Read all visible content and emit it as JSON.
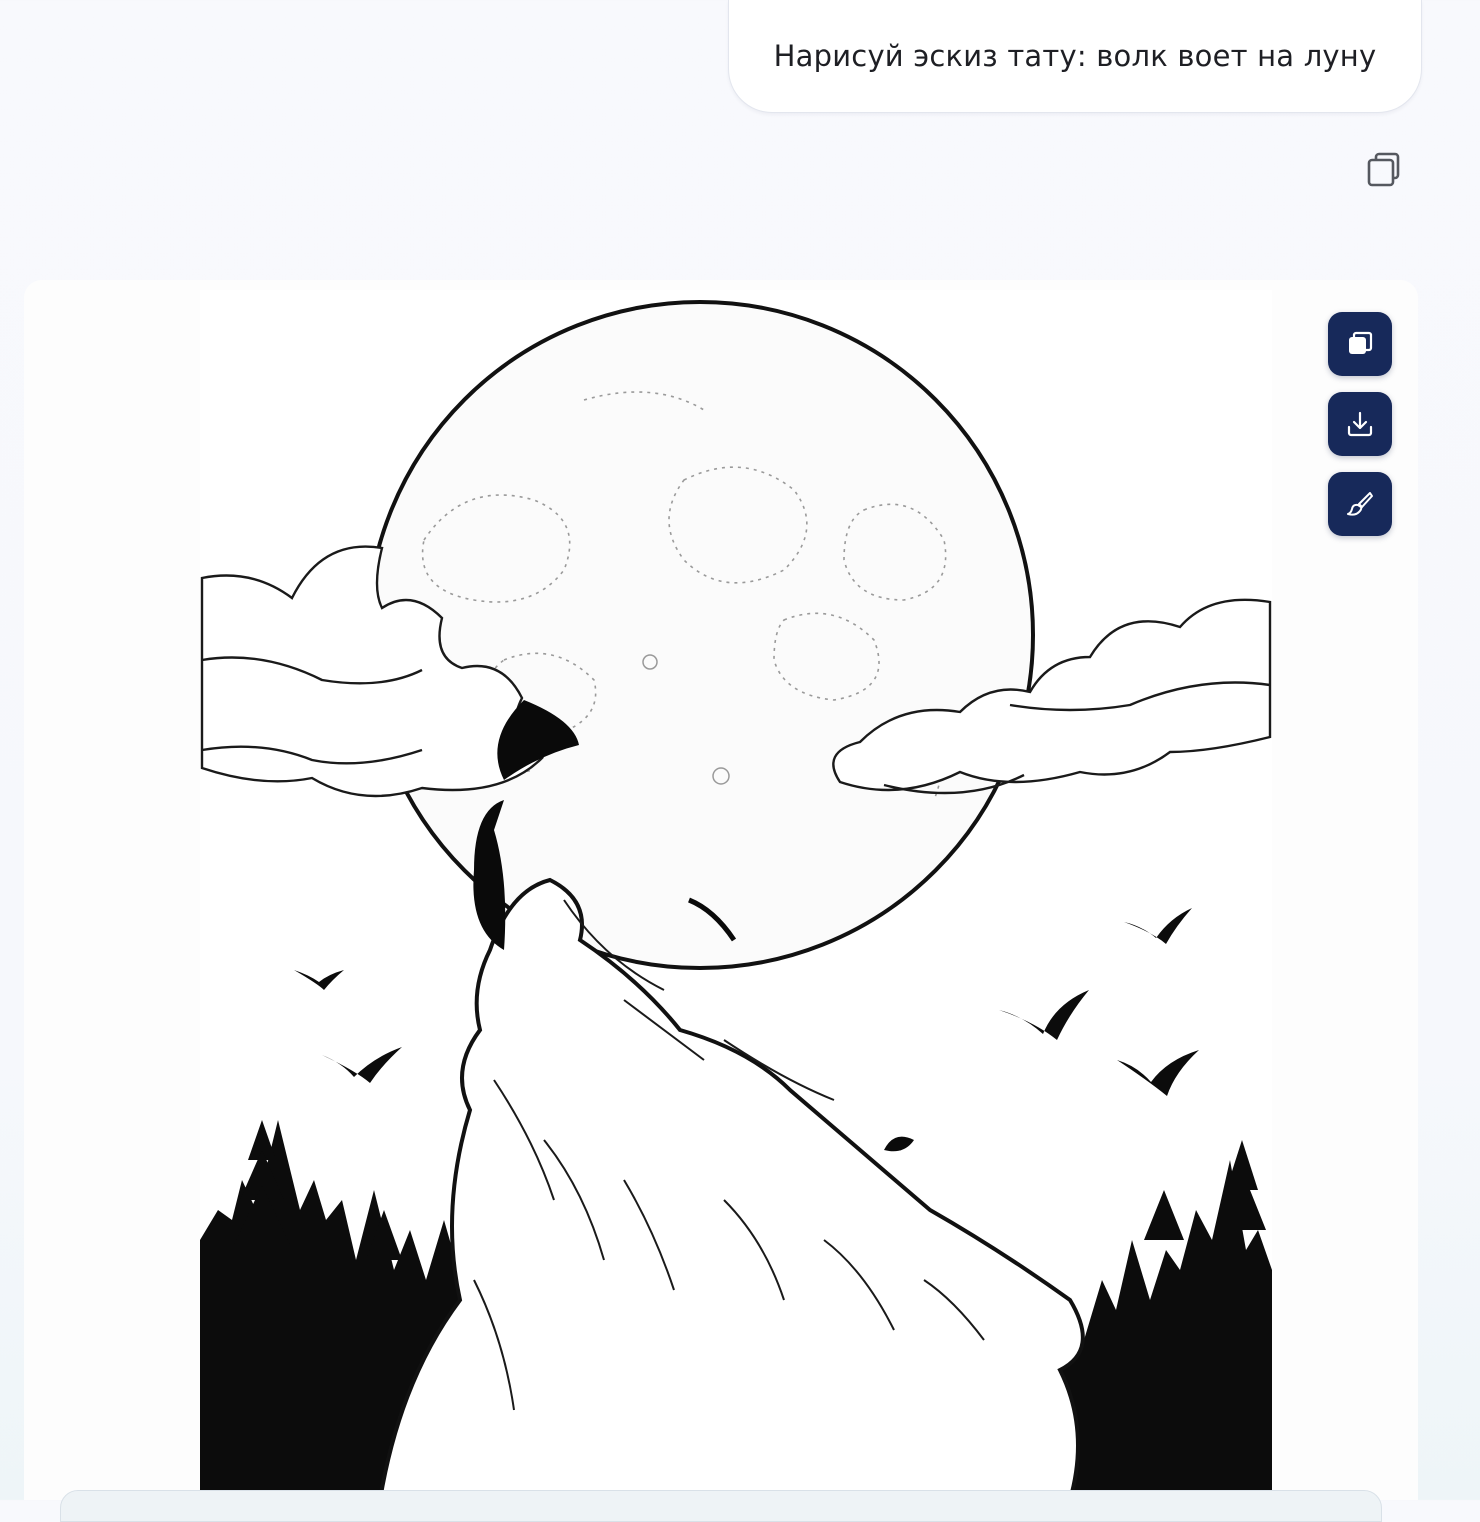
{
  "chat": {
    "user_message": "Нарисуй эскиз тату: волк воет на луну"
  },
  "icons": {
    "copy_message": "copy-icon",
    "copy_image": "copy-icon",
    "download_image": "download-icon",
    "edit_image": "brush-icon"
  },
  "colors": {
    "action_button_bg": "#17295a",
    "action_icon": "#ffffff",
    "user_bubble_bg": "#ffffff",
    "page_bg": "#f8f9fd"
  }
}
